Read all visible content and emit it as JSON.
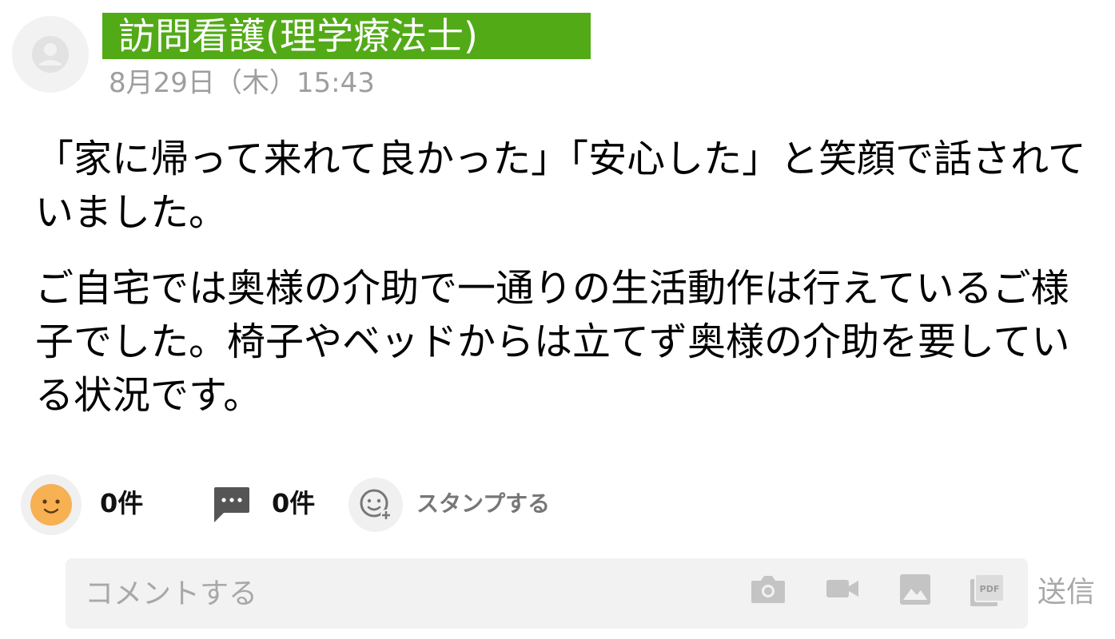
{
  "post": {
    "author": "訪問看護(理学療法士)",
    "timestamp": "8月29日（木）15:43",
    "paragraphs": [
      "「家に帰って来れて良かった」「安心した」と笑顔で話されていました。",
      "ご自宅では奥様の介助で一通りの生活動作は行えているご様子でした。椅子やベッドからは立てず奥様の介助を要している状況です。"
    ]
  },
  "reactions": {
    "reaction_icon": "smile-face-icon",
    "reaction_count": "0件",
    "comment_icon": "speech-bubble-icon",
    "comment_count": "0件",
    "stamp_icon": "add-emoji-icon",
    "stamp_label": "スタンプする"
  },
  "composer": {
    "placeholder": "コメントする",
    "attachments": [
      "camera-icon",
      "video-camera-icon",
      "image-icon",
      "pdf-icon"
    ],
    "send_label": "送信"
  },
  "colors": {
    "author_banner": "#52aa17",
    "timestamp": "#9e9e9e",
    "placeholder": "#a8a8a8",
    "reaction_face": "#f7b052"
  }
}
